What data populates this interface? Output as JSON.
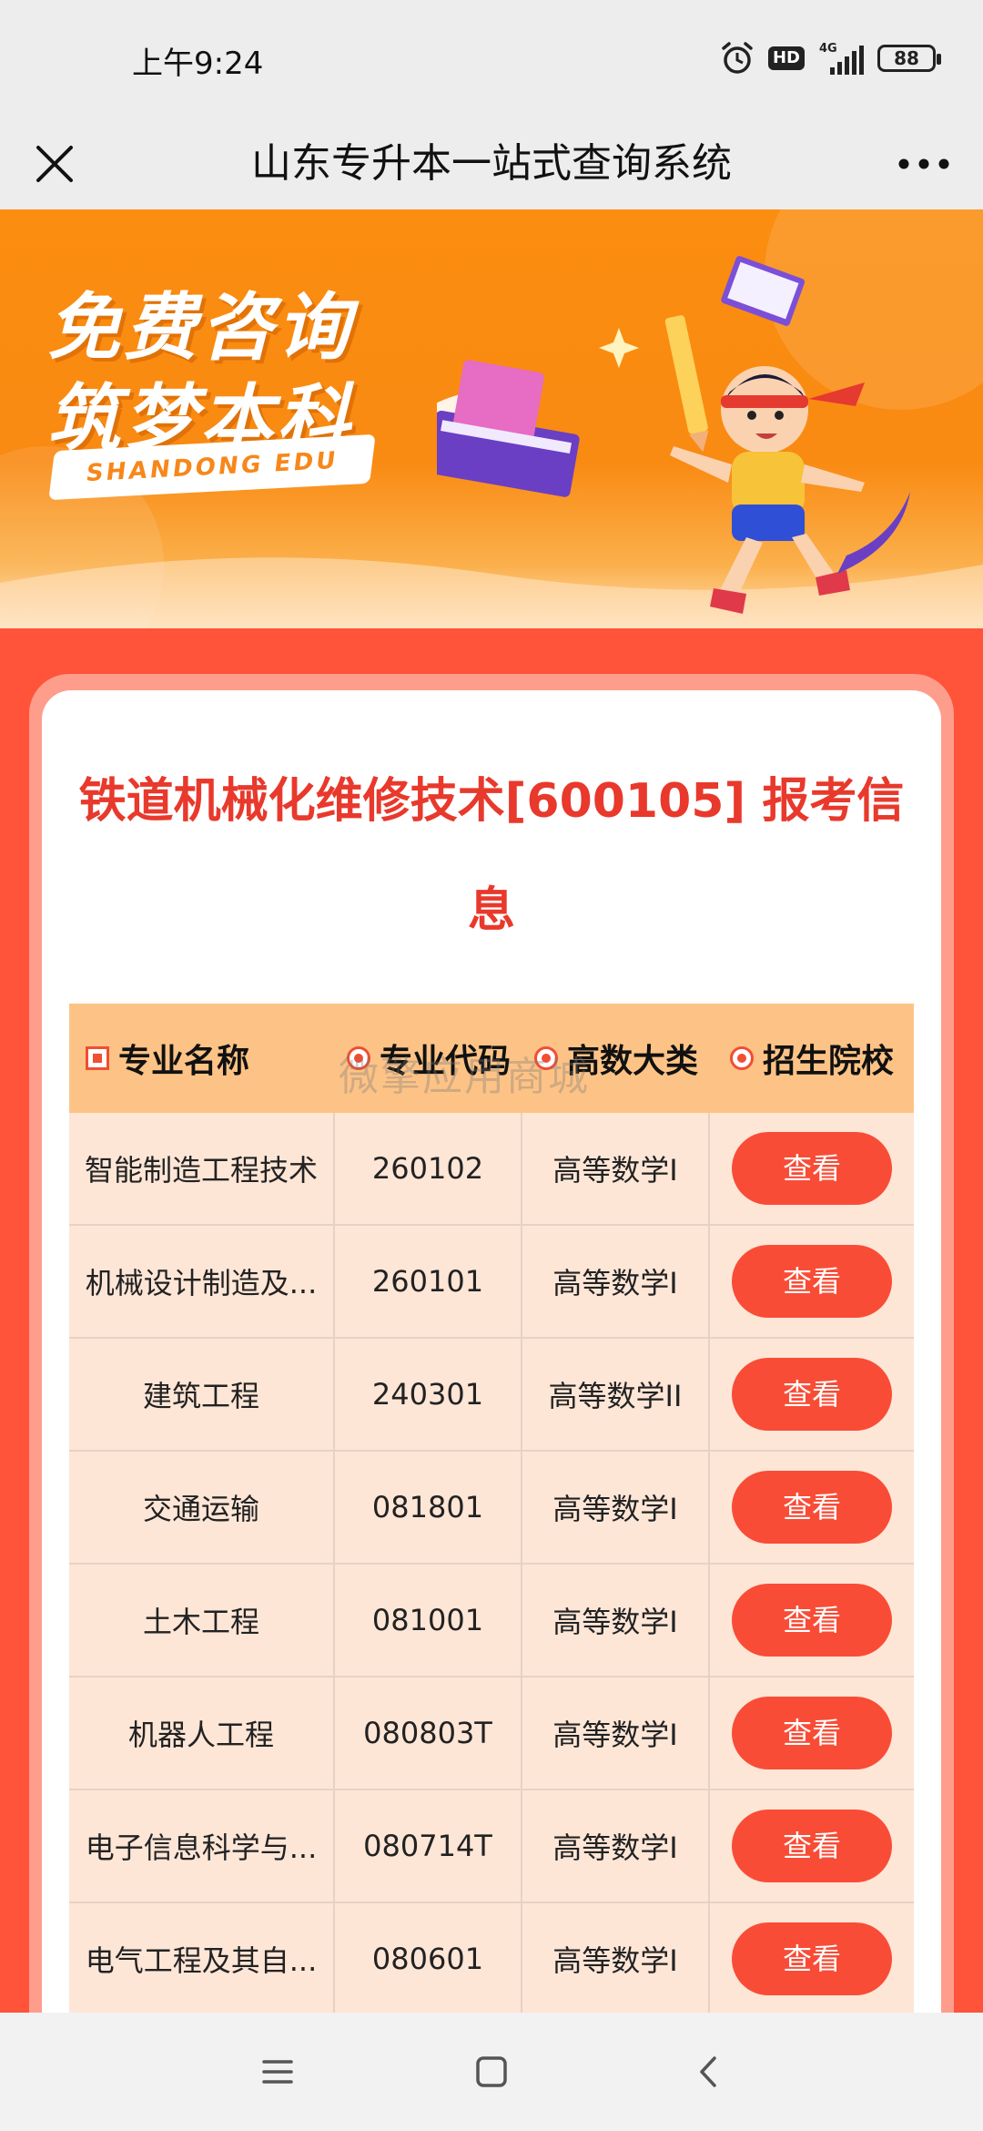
{
  "status_bar": {
    "time": "上午9:24",
    "hd_label": "HD",
    "network_label": "4G",
    "battery": "88"
  },
  "header": {
    "title": "山东专升本一站式查询系统",
    "close_icon": "close-icon",
    "more_icon": "more-icon"
  },
  "banner": {
    "line1": "免费咨询",
    "line2": "筑梦本科",
    "tag": "SHANDONG EDU"
  },
  "card": {
    "title": "铁道机械化维修技术[600105] 报考信息"
  },
  "table": {
    "headers": [
      "专业名称",
      "专业代码",
      "高数大类",
      "招生院校"
    ],
    "watermark": "微擎应用商城",
    "rows": [
      {
        "name": "智能制造工程技术",
        "code": "260102",
        "math": "高等数学I",
        "action": "查看"
      },
      {
        "name": "机械设计制造及...",
        "code": "260101",
        "math": "高等数学I",
        "action": "查看"
      },
      {
        "name": "建筑工程",
        "code": "240301",
        "math": "高等数学II",
        "action": "查看"
      },
      {
        "name": "交通运输",
        "code": "081801",
        "math": "高等数学I",
        "action": "查看"
      },
      {
        "name": "土木工程",
        "code": "081001",
        "math": "高等数学I",
        "action": "查看"
      },
      {
        "name": "机器人工程",
        "code": "080803T",
        "math": "高等数学I",
        "action": "查看"
      },
      {
        "name": "电子信息科学与...",
        "code": "080714T",
        "math": "高等数学I",
        "action": "查看"
      },
      {
        "name": "电气工程及其自...",
        "code": "080601",
        "math": "高等数学I",
        "action": "查看"
      }
    ]
  },
  "nav_bar": {
    "icons": [
      "menu-icon",
      "home-icon",
      "back-icon"
    ]
  },
  "colors": {
    "accent": "#f94c36",
    "title_red": "#e8392c",
    "header_orange": "#fdc386",
    "row_bg": "#fee6d7"
  }
}
